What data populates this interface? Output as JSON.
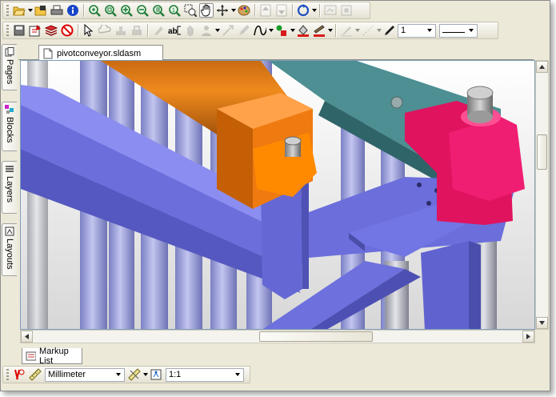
{
  "document": {
    "tab_label": "pivotconveyor.sldasm"
  },
  "side_tabs": [
    "Pages",
    "Blocks",
    "Layers",
    "Layouts"
  ],
  "toolbar2": {
    "line_width_value": "1"
  },
  "bottom": {
    "markup_list_label": "Markup List",
    "unit_value": "Millimeter",
    "scale_value": "1:1"
  },
  "colors": {
    "frame_blue": "#6b6ee0",
    "cylinder_orange": "#ef7b10",
    "bracket_orange": "#ff8a00",
    "rail_teal": "#4a8b8f",
    "pivot_magenta": "#e0105f",
    "post_lavender": "#9fa3d3"
  },
  "icons": {
    "toolbar1": [
      "open-folder-icon",
      "open-file-icon",
      "print-icon",
      "info-icon",
      "zoom-in-area-icon",
      "zoom-fit-icon",
      "zoom-in-icon",
      "zoom-out-icon",
      "zoom-previous-icon",
      "zoom-window-icon",
      "zoom-selection-icon",
      "pan-icon",
      "rotate-icon",
      "palette-icon",
      "page-up-icon",
      "page-down-icon",
      "refresh-icon",
      "export-icon",
      "settings-icon"
    ],
    "toolbar2": [
      "save-markup-icon",
      "markup-properties-icon",
      "layers-stack-icon",
      "delete-markup-icon",
      "select-arrow-icon",
      "undo-cloud-icon",
      "stamp-icon",
      "stamp2-icon",
      "eraser-icon",
      "text-icon",
      "hand-icon",
      "person-icon",
      "arrow-icon",
      "pencil-icon",
      "curve-icon",
      "shapes-icon",
      "fill-color-icon",
      "line-color-icon",
      "brush-icon",
      "dimension-icon",
      "pen-icon"
    ]
  }
}
